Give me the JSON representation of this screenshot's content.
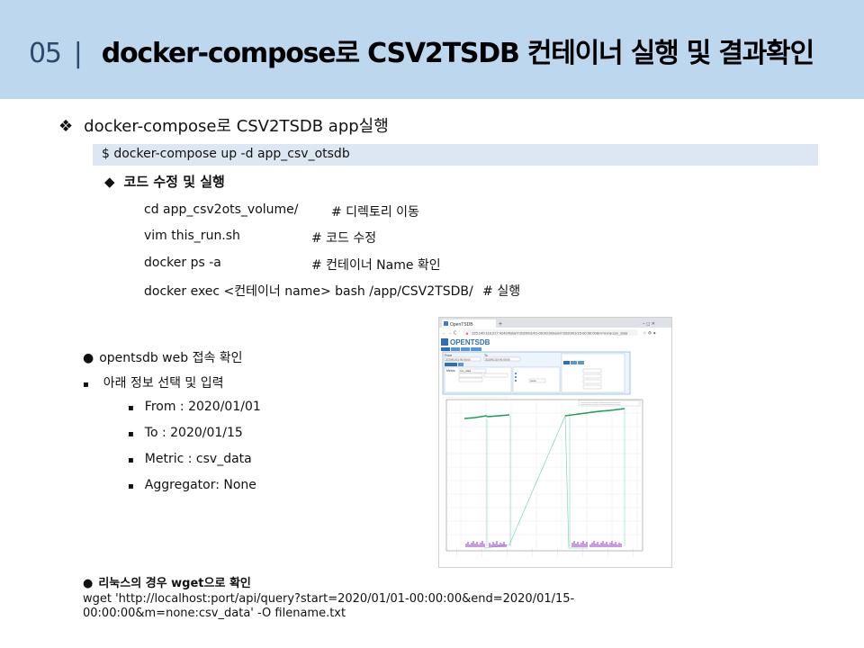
{
  "header": {
    "number": "05",
    "separator": "|",
    "title": "docker-compose로 CSV2TSDB 컨테이너 실행 및 결과확인"
  },
  "section1": {
    "bullet": "❖",
    "title": "docker-compose로 CSV2TSDB app실행",
    "command": "$ docker-compose up -d app_csv_otsdb"
  },
  "section2": {
    "bullet": "◆",
    "title": "코드 수정 및 실행",
    "lines": [
      {
        "cmd": "cd app_csv2ots_volume/",
        "comment": "# 디렉토리 이동"
      },
      {
        "cmd": "vim this_run.sh",
        "comment": "# 코드 수정"
      },
      {
        "cmd": "docker ps -a",
        "comment": "# 컨테이너 Name 확인"
      },
      {
        "cmd": "docker exec <컨테이너 name> bash /app/CSV2TSDB/",
        "comment": "# 실행"
      }
    ]
  },
  "section3": {
    "bullet": "●",
    "title": "opentsdb web 접속 확인",
    "sub_bullet": "▪",
    "sub_title": "아래 정보 선택 및 입력",
    "items": [
      "From : 2020/01/01",
      "To : 2020/01/15",
      "Metric : csv_data",
      "Aggregator: None"
    ]
  },
  "section4": {
    "bullet": "●",
    "title": "리눅스의 경우 wget으로 확인",
    "line1": "wget 'http://localhost:port/api/query?start=2020/01/01-00:00:00&end=2020/01/15-",
    "line2": "00:00:00&m=none:csv_data' -O filename.txt"
  },
  "screenshot": {
    "tab_title": "OpenTSDB",
    "url": "125.140.110.217:4242/#start=2020/01/01-00:00:00&end=2020/01/15-00:00:00&m=none:csv_data",
    "logo": "OPENTSDB",
    "from_label": "From",
    "to_label": "To",
    "from_value": "2020/01/01-00:00:00",
    "to_value": "2020/01/15-00:00:00",
    "metric_label": "Metric:",
    "metric_value": "csv_data",
    "aggregator_value": "none",
    "colors": {
      "line": "#1a9e5a",
      "connector": "#6fc9b8",
      "bars": "#8a1fc4"
    }
  }
}
